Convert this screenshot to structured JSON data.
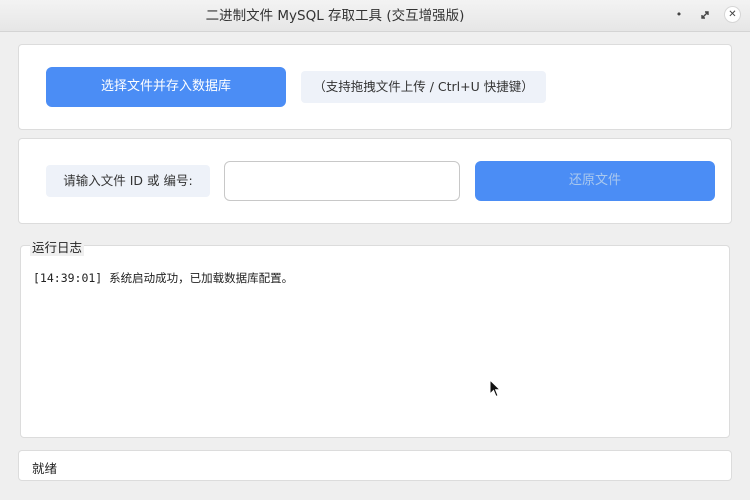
{
  "window": {
    "title": "二进制文件 MySQL 存取工具 (交互增强版)"
  },
  "upload": {
    "button_label": "选择文件并存入数据库",
    "hint": "（支持拖拽文件上传 / Ctrl+U 快捷键）"
  },
  "restore": {
    "label": "请输入文件 ID 或 编号:",
    "input_value": "",
    "input_placeholder": "",
    "button_label": "还原文件"
  },
  "log": {
    "title": "运行日志",
    "entries": [
      "[14:39:01] 系统启动成功，已加载数据库配置。"
    ]
  },
  "status": {
    "text": "就绪"
  },
  "colors": {
    "accent": "#4b8df5",
    "disabled_text": "#a9c8ee"
  }
}
